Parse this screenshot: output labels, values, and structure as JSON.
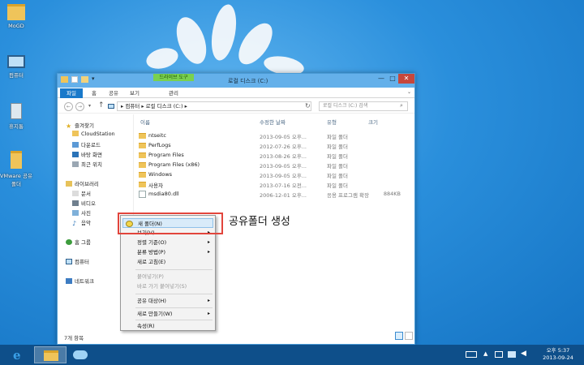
{
  "desktop": {
    "icons": [
      {
        "label": "MoGD"
      },
      {
        "label": "컴퓨터"
      },
      {
        "label": "휴지통"
      },
      {
        "label": "VMware 공유 폴더"
      }
    ]
  },
  "window": {
    "title": "로컬 디스크 (C:)",
    "context_tab": "드라이브 도구",
    "title_controls": {
      "minimize": "—",
      "maximize": "□",
      "close": "✕"
    },
    "ribbon_tabs": [
      "파일",
      "홈",
      "공유",
      "보기",
      "관리"
    ],
    "address": {
      "path": "▸ 컴퓨터 ▸ 로컬 디스크 (C:) ▸",
      "search_placeholder": "로컬 디스크 (C:) 검색"
    },
    "nav": {
      "favorites": "즐겨찾기",
      "favorites_items": [
        "CloudStation",
        "다운로드",
        "바탕 화면",
        "최근 위치"
      ],
      "libraries": "라이브러리",
      "libraries_items": [
        "문서",
        "비디오",
        "사진",
        "음악"
      ],
      "homegroup": "홈 그룹",
      "computer": "컴퓨터",
      "network": "네트워크"
    },
    "columns": {
      "name": "이름",
      "date": "수정한 날짜",
      "type": "유형",
      "size": "크기"
    },
    "files": [
      {
        "name": "ntseitc",
        "date": "2013-09-05 오후...",
        "type": "파일 폴더",
        "size": ""
      },
      {
        "name": "PerfLogs",
        "date": "2012-07-26 오후...",
        "type": "파일 폴더",
        "size": ""
      },
      {
        "name": "Program Files",
        "date": "2013-08-26 오후...",
        "type": "파일 폴더",
        "size": ""
      },
      {
        "name": "Program Files (x86)",
        "date": "2013-09-05 오후...",
        "type": "파일 폴더",
        "size": ""
      },
      {
        "name": "Windows",
        "date": "2013-09-05 오후...",
        "type": "파일 폴더",
        "size": ""
      },
      {
        "name": "사용자",
        "date": "2013-07-16 오전...",
        "type": "파일 폴더",
        "size": ""
      },
      {
        "name": "msdia80.dll",
        "date": "2006-12-01 오후...",
        "type": "응용 프로그램 확장",
        "size": "884KB"
      }
    ],
    "status": "7개 항목"
  },
  "context_menu": {
    "items": [
      {
        "label": "새 폴더(N)",
        "arrow": ""
      },
      {
        "label": "보기(V)",
        "arrow": "▸"
      },
      {
        "label": "정렬 기준(O)",
        "arrow": "▸"
      },
      {
        "label": "분류 방법(P)",
        "arrow": "▸"
      },
      {
        "label": "새로 고침(E)",
        "arrow": ""
      },
      {
        "label": "붙여넣기(P)",
        "arrow": ""
      },
      {
        "label": "바로 가기 붙여넣기(S)",
        "arrow": ""
      },
      {
        "label": "공유 대상(H)",
        "arrow": "▸"
      },
      {
        "label": "새로 만들기(W)",
        "arrow": "▸"
      },
      {
        "label": "속성(R)",
        "arrow": ""
      }
    ]
  },
  "annotation": "공유폴더 생성",
  "taskbar": {
    "time": "오후 5:37",
    "date": "2013-09-24"
  },
  "colors": {
    "accent": "#1979ca",
    "highlight_box": "#e2453c",
    "context_tab": "#7ad14e"
  }
}
